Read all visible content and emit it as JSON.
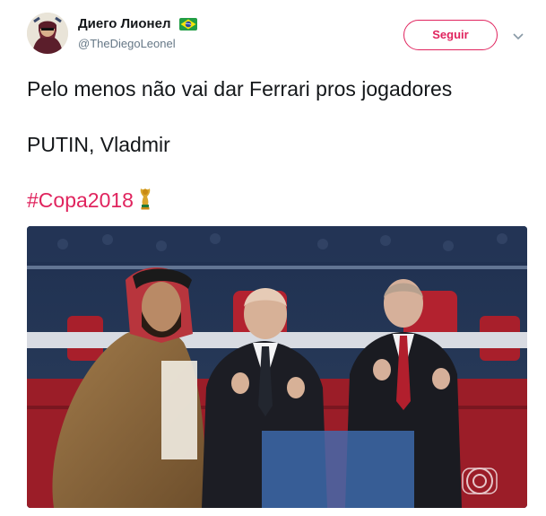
{
  "user": {
    "display_name": "Диего Лионел",
    "handle": "@TheDiegoLeonel",
    "flag_icon": "brazil-flag-icon"
  },
  "follow_label": "Seguir",
  "tweet": {
    "line1": "Pelo menos não vai dar Ferrari pros jogadores",
    "line2": "PUTIN, Vladmir",
    "hashtag": "#Copa2018",
    "hashtag_icon": "world-cup-trophy-icon"
  },
  "colors": {
    "accent": "#e0245e",
    "text": "#14171a",
    "secondary": "#657786"
  }
}
